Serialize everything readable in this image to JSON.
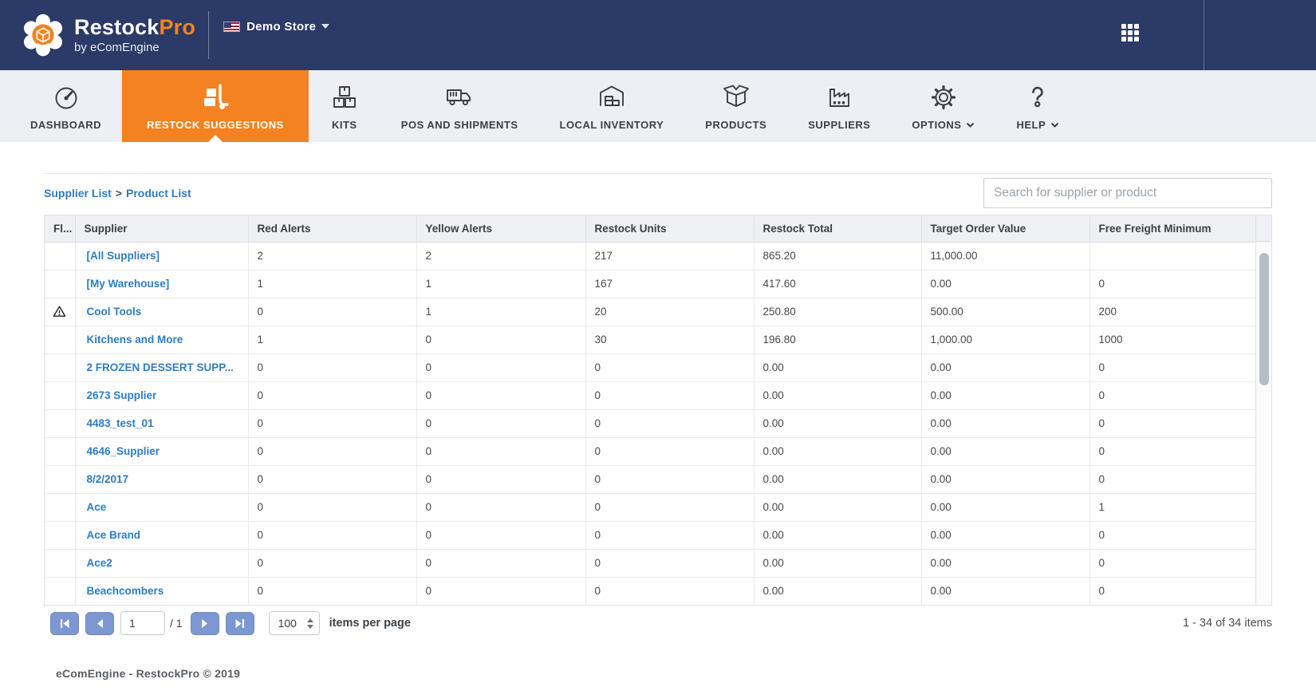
{
  "topbar": {
    "brand": {
      "primary": "Restock",
      "accent": "Pro",
      "tagline": "by eComEngine"
    },
    "store_label": "Demo Store"
  },
  "nav": {
    "items": [
      {
        "label": "DASHBOARD",
        "icon": "gauge-icon",
        "active": false
      },
      {
        "label": "RESTOCK SUGGESTIONS",
        "icon": "hand-truck-icon",
        "active": true
      },
      {
        "label": "KITS",
        "icon": "stacked-boxes-icon",
        "active": false
      },
      {
        "label": "POS AND SHIPMENTS",
        "icon": "truck-icon",
        "active": false
      },
      {
        "label": "LOCAL INVENTORY",
        "icon": "warehouse-icon",
        "active": false
      },
      {
        "label": "PRODUCTS",
        "icon": "open-box-icon",
        "active": false
      },
      {
        "label": "SUPPLIERS",
        "icon": "factory-icon",
        "active": false
      },
      {
        "label": "OPTIONS",
        "icon": "gear-icon",
        "has_caret": true,
        "active": false
      },
      {
        "label": "HELP",
        "icon": "question-mark-icon",
        "has_caret": true,
        "active": false
      }
    ]
  },
  "breadcrumb": {
    "supplier_list": "Supplier List",
    "separator": ">",
    "product_list": "Product List"
  },
  "search": {
    "placeholder": "Search for supplier or product",
    "value": ""
  },
  "table": {
    "columns": [
      "Fl...",
      "Supplier",
      "Red Alerts",
      "Yellow Alerts",
      "Restock Units",
      "Restock Total",
      "Target Order Value",
      "Free Freight Minimum"
    ],
    "rows": [
      {
        "flag": false,
        "supplier": "[All Suppliers]",
        "red_alerts": "2",
        "yellow_alerts": "2",
        "restock_units": "217",
        "restock_total": "865.20",
        "target_order_value": "11,000.00",
        "free_freight_minimum": ""
      },
      {
        "flag": false,
        "supplier": "[My Warehouse]",
        "red_alerts": "1",
        "yellow_alerts": "1",
        "restock_units": "167",
        "restock_total": "417.60",
        "target_order_value": "0.00",
        "free_freight_minimum": "0"
      },
      {
        "flag": true,
        "supplier": "Cool Tools",
        "red_alerts": "0",
        "yellow_alerts": "1",
        "restock_units": "20",
        "restock_total": "250.80",
        "target_order_value": "500.00",
        "free_freight_minimum": "200"
      },
      {
        "flag": false,
        "supplier": "Kitchens and More",
        "red_alerts": "1",
        "yellow_alerts": "0",
        "restock_units": "30",
        "restock_total": "196.80",
        "target_order_value": "1,000.00",
        "free_freight_minimum": "1000"
      },
      {
        "flag": false,
        "supplier": "2 FROZEN DESSERT SUPP...",
        "red_alerts": "0",
        "yellow_alerts": "0",
        "restock_units": "0",
        "restock_total": "0.00",
        "target_order_value": "0.00",
        "free_freight_minimum": "0"
      },
      {
        "flag": false,
        "supplier": "2673 Supplier",
        "red_alerts": "0",
        "yellow_alerts": "0",
        "restock_units": "0",
        "restock_total": "0.00",
        "target_order_value": "0.00",
        "free_freight_minimum": "0"
      },
      {
        "flag": false,
        "supplier": "4483_test_01",
        "red_alerts": "0",
        "yellow_alerts": "0",
        "restock_units": "0",
        "restock_total": "0.00",
        "target_order_value": "0.00",
        "free_freight_minimum": "0"
      },
      {
        "flag": false,
        "supplier": "4646_Supplier",
        "red_alerts": "0",
        "yellow_alerts": "0",
        "restock_units": "0",
        "restock_total": "0.00",
        "target_order_value": "0.00",
        "free_freight_minimum": "0"
      },
      {
        "flag": false,
        "supplier": "8/2/2017",
        "red_alerts": "0",
        "yellow_alerts": "0",
        "restock_units": "0",
        "restock_total": "0.00",
        "target_order_value": "0.00",
        "free_freight_minimum": "0"
      },
      {
        "flag": false,
        "supplier": "Ace",
        "red_alerts": "0",
        "yellow_alerts": "0",
        "restock_units": "0",
        "restock_total": "0.00",
        "target_order_value": "0.00",
        "free_freight_minimum": "1"
      },
      {
        "flag": false,
        "supplier": "Ace Brand",
        "red_alerts": "0",
        "yellow_alerts": "0",
        "restock_units": "0",
        "restock_total": "0.00",
        "target_order_value": "0.00",
        "free_freight_minimum": "0"
      },
      {
        "flag": false,
        "supplier": "Ace2",
        "red_alerts": "0",
        "yellow_alerts": "0",
        "restock_units": "0",
        "restock_total": "0.00",
        "target_order_value": "0.00",
        "free_freight_minimum": "0"
      },
      {
        "flag": false,
        "supplier": "Beachcombers",
        "red_alerts": "0",
        "yellow_alerts": "0",
        "restock_units": "0",
        "restock_total": "0.00",
        "target_order_value": "0.00",
        "free_freight_minimum": "0"
      }
    ]
  },
  "pagination": {
    "page_value": "1",
    "of_label": "/ 1",
    "page_size": "100",
    "items_per_page_label": "items per page",
    "range_label": "1 - 34 of 34 items"
  },
  "footer": {
    "copyright": "eComEngine - RestockPro © 2019"
  },
  "colors": {
    "brand_navy": "#2b3a67",
    "brand_orange": "#f58220",
    "link_blue": "#2e7cc3",
    "pager_button_blue": "#7d97d2"
  }
}
